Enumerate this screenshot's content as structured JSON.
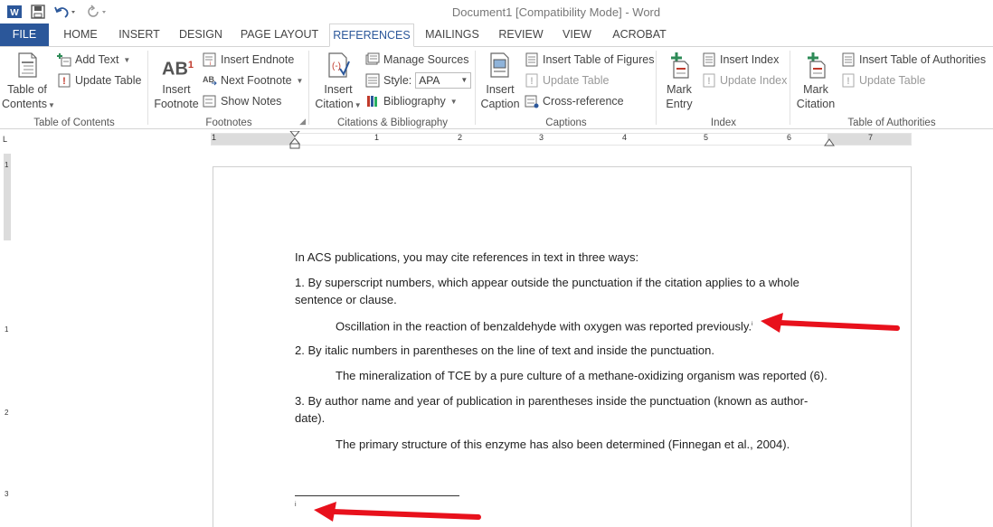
{
  "app": {
    "title": "Document1 [Compatibility Mode] - Word",
    "icons": [
      "word-logo-icon",
      "save-icon",
      "undo-icon",
      "redo-icon"
    ]
  },
  "tabs": [
    "FILE",
    "HOME",
    "INSERT",
    "DESIGN",
    "PAGE LAYOUT",
    "REFERENCES",
    "MAILINGS",
    "REVIEW",
    "VIEW",
    "ACROBAT"
  ],
  "active_tab": "REFERENCES",
  "ribbon": {
    "toc": {
      "big_line1": "Table of",
      "big_line2": "Contents",
      "add_text": "Add Text",
      "update_table": "Update Table",
      "label": "Table of Contents"
    },
    "footnotes": {
      "big_line1": "Insert",
      "big_line2": "Footnote",
      "big_icon_text": "AB",
      "big_icon_sup": "1",
      "insert_endnote": "Insert Endnote",
      "next_footnote": "Next Footnote",
      "show_notes": "Show Notes",
      "label": "Footnotes"
    },
    "citations": {
      "big_line1": "Insert",
      "big_line2": "Citation",
      "manage_sources": "Manage Sources",
      "style_label": "Style:",
      "style_value": "APA",
      "bibliography": "Bibliography",
      "label": "Citations & Bibliography"
    },
    "captions": {
      "big_line1": "Insert",
      "big_line2": "Caption",
      "insert_tof": "Insert Table of Figures",
      "update_table": "Update Table",
      "cross_reference": "Cross-reference",
      "label": "Captions"
    },
    "index": {
      "big_line1": "Mark",
      "big_line2": "Entry",
      "insert_index": "Insert Index",
      "update_index": "Update Index",
      "label": "Index"
    },
    "authorities": {
      "big_line1": "Mark",
      "big_line2": "Citation",
      "insert_toa": "Insert Table of Authorities",
      "update_table": "Update Table",
      "label": "Table of Authorities"
    }
  },
  "ruler": {
    "h_numbers": [
      "1",
      "1",
      "2",
      "3",
      "4",
      "5",
      "6",
      "7"
    ],
    "v_numbers": [
      "1",
      "1",
      "2",
      "3"
    ],
    "tab_selector": "L"
  },
  "document": {
    "p1": "In ACS publications, you may cite references in text in three ways:",
    "p2": "1. By superscript numbers, which appear outside the punctuation if the citation applies to a whole sentence or clause.",
    "p3": "Oscillation in the reaction of benzaldehyde with oxygen was reported previously.",
    "p3_sup": "i",
    "p4": "2. By italic numbers in parentheses on the line of text and inside the punctuation.",
    "p5": "The mineralization of TCE by a pure culture of a methane-oxidizing organism was reported (6).",
    "p6": "3. By author name and year of publication in parentheses inside the punctuation (known as author-date).",
    "p7": "The primary structure of this enzyme has also been determined (Finnegan et al., 2004).",
    "footnote_marker": "i"
  },
  "colors": {
    "file_tab": "#2b579a",
    "active_tab_text": "#2b579a",
    "arrow": "#e8111c"
  }
}
